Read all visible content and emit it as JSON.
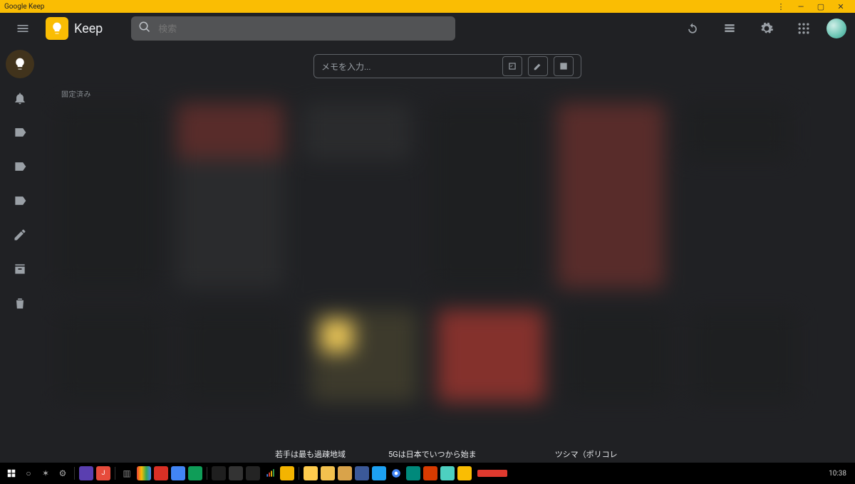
{
  "window": {
    "title": "Google Keep"
  },
  "header": {
    "app_name": "Keep",
    "search_placeholder": "検索"
  },
  "compose": {
    "placeholder": "メモを入力..."
  },
  "sections": {
    "pinned_label": "固定済み"
  },
  "overlay": {
    "label1": "若手は最も過疎地域",
    "label2": "5Gは日本でいつから始ま",
    "label3": "ツシマ（ポリコレ"
  },
  "taskbar": {
    "clock": "10:38"
  }
}
